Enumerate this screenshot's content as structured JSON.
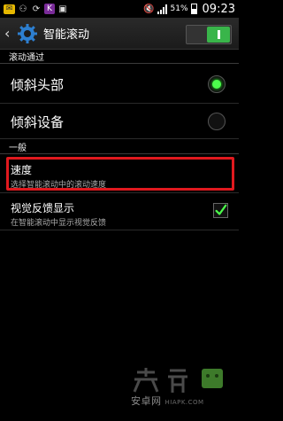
{
  "status_bar": {
    "battery": "51%",
    "time": "09:23"
  },
  "action_bar": {
    "title": "智能滚动",
    "toggle_on": true
  },
  "sections": {
    "scroll_by": "滚动通过",
    "general": "一般"
  },
  "options": [
    {
      "label": "倾斜头部",
      "selected": true
    },
    {
      "label": "倾斜设备",
      "selected": false
    }
  ],
  "speed": {
    "title": "速度",
    "subtitle": "选择智能滚动中的滚动速度"
  },
  "visual_feedback": {
    "title": "视觉反馈显示",
    "subtitle": "在智能滚动中显示视觉反馈",
    "checked": true
  },
  "watermark": {
    "text": "安卓网",
    "sub": "HIAPK.COM"
  },
  "colors": {
    "accent": "#39b54a",
    "highlight": "#e0191e"
  }
}
